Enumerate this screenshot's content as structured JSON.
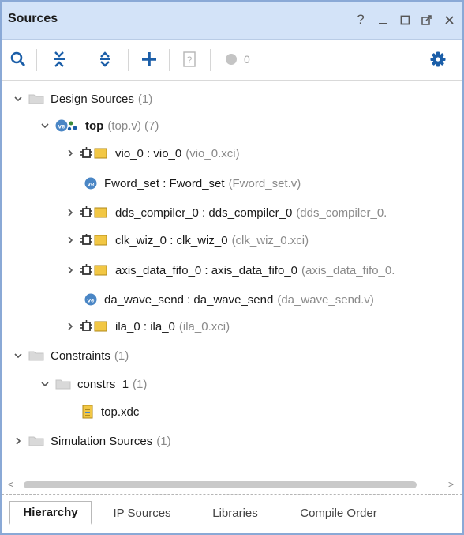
{
  "titlebar": {
    "title": "Sources",
    "help": "?",
    "minimize": "_",
    "maximize": "□",
    "float": "⇱",
    "close": "×"
  },
  "toolbar": {
    "count": "0",
    "icons": [
      "search-icon",
      "collapse-all-icon",
      "expand-all-icon",
      "add-icon",
      "unknown-file-icon",
      "status-dot-icon",
      "gear-icon"
    ],
    "accent": "#1b5ea8"
  },
  "tree": {
    "design_sources": {
      "label": "Design Sources",
      "count": "(1)"
    },
    "top": {
      "label": "top",
      "sub": "(top.v) (7)"
    },
    "vio": {
      "label": "vio_0 : vio_0",
      "sub": "(vio_0.xci)"
    },
    "fword": {
      "label": "Fword_set : Fword_set",
      "sub": "(Fword_set.v)"
    },
    "dds": {
      "label": "dds_compiler_0 : dds_compiler_0",
      "sub": "(dds_compiler_0."
    },
    "clk": {
      "label": "clk_wiz_0 : clk_wiz_0",
      "sub": "(clk_wiz_0.xci)"
    },
    "axis": {
      "label": "axis_data_fifo_0 : axis_data_fifo_0",
      "sub": "(axis_data_fifo_0."
    },
    "da": {
      "label": "da_wave_send : da_wave_send",
      "sub": "(da_wave_send.v)"
    },
    "ila": {
      "label": "ila_0 : ila_0",
      "sub": "(ila_0.xci)"
    },
    "constraints": {
      "label": "Constraints",
      "count": "(1)"
    },
    "constrs": {
      "label": "constrs_1",
      "count": "(1)"
    },
    "xdc": {
      "label": "top.xdc"
    },
    "sim": {
      "label": "Simulation Sources",
      "count": "(1)"
    }
  },
  "tabs": [
    {
      "label": "Hierarchy",
      "active": true
    },
    {
      "label": "IP Sources"
    },
    {
      "label": "Libraries"
    },
    {
      "label": "Compile Order"
    }
  ],
  "colors": {
    "titlebar_bg": "#d3e3f8",
    "border": "#8aa9d6",
    "ip_yellow": "#f2c744",
    "ve_blue": "#4a86c5"
  }
}
